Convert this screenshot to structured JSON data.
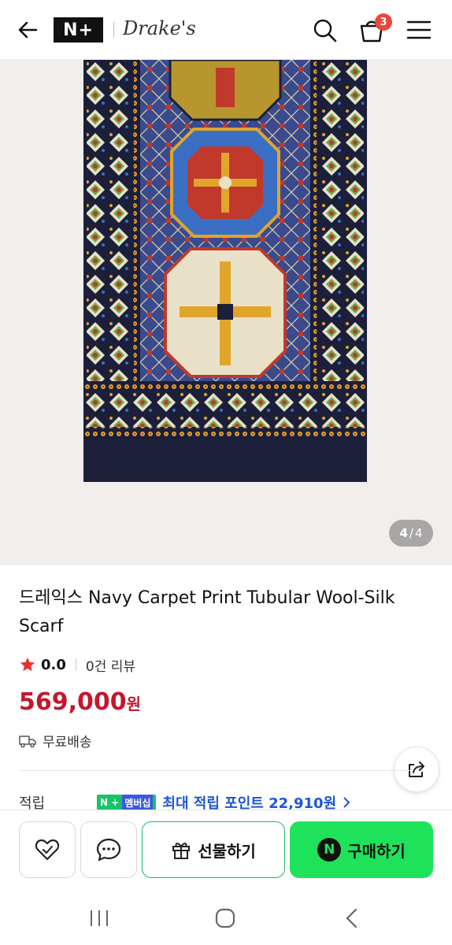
{
  "header": {
    "brand_badge": "N+",
    "brand_name": "Drake's",
    "cart_count": "3"
  },
  "gallery": {
    "current": "4",
    "separator": "/",
    "total": "4"
  },
  "product": {
    "title": "드레익스 Navy Carpet Print Tubular Wool-Silk Scarf",
    "rating": "0.0",
    "review_count": "0건 리뷰",
    "price": "569,000",
    "currency": "원",
    "shipping": "무료배송"
  },
  "points": {
    "label": "적립",
    "badge_n": "N +",
    "badge_member": "멤버십",
    "text": "최대 적립 포인트 22,910원"
  },
  "actions": {
    "gift_label": "선물하기",
    "buy_label": "구매하기",
    "buy_logo": "N"
  },
  "colors": {
    "price": "#c2182d",
    "buy_button": "#1ee35a",
    "badge": "#e8473b",
    "points": "#1a56d6"
  }
}
